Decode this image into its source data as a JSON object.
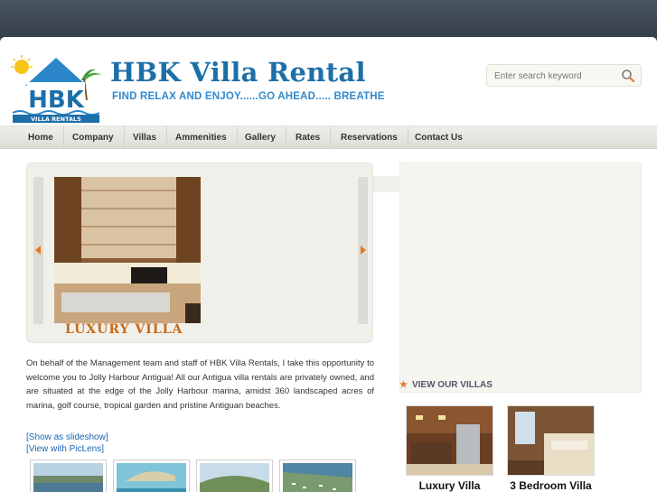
{
  "site": {
    "title": "HBK Villa Rental",
    "tagline": "FIND RELAX AND ENJOY......GO AHEAD..... BREATHE",
    "logo_text": "HBK",
    "logo_subtext": "VILLA RENTALS"
  },
  "search": {
    "placeholder": "Enter search keyword"
  },
  "nav": {
    "items": [
      {
        "label": "Home"
      },
      {
        "label": "Company"
      },
      {
        "label": "Villas"
      },
      {
        "label": "Ammenities"
      },
      {
        "label": "Gallery"
      },
      {
        "label": "Rates"
      },
      {
        "label": "Reservations"
      },
      {
        "label": "Contact Us"
      }
    ]
  },
  "slider": {
    "caption": "LUXURY VILLA"
  },
  "intro": {
    "text": "On behalf of the Management team and staff of HBK Villa Rentals, I take this opportunity to welcome you to Jolly Harbour Antigua! All our Antigua villa rentals are privately owned, and are situated at the edge of the Jolly Harbour marina, amidst 360 landscaped acres of marina, golf course, tropical garden and pristine Antiguan beaches."
  },
  "gallery_links": {
    "slideshow": "[Show as slideshow]",
    "piclens": "[View with PicLens]"
  },
  "villas": {
    "heading": "VIEW OUR VILLAS",
    "items": [
      {
        "name": "Luxury Villa"
      },
      {
        "name": "3 Bedroom Villa"
      }
    ]
  },
  "colors": {
    "brand_blue": "#1d6fa8",
    "accent_orange": "#e87722",
    "link_blue": "#1a66b0"
  },
  "icons": {
    "search": "magnifier-icon",
    "slider_prev": "arrow-left-icon",
    "slider_next": "arrow-right-icon",
    "heading_bullet": "star-icon"
  }
}
